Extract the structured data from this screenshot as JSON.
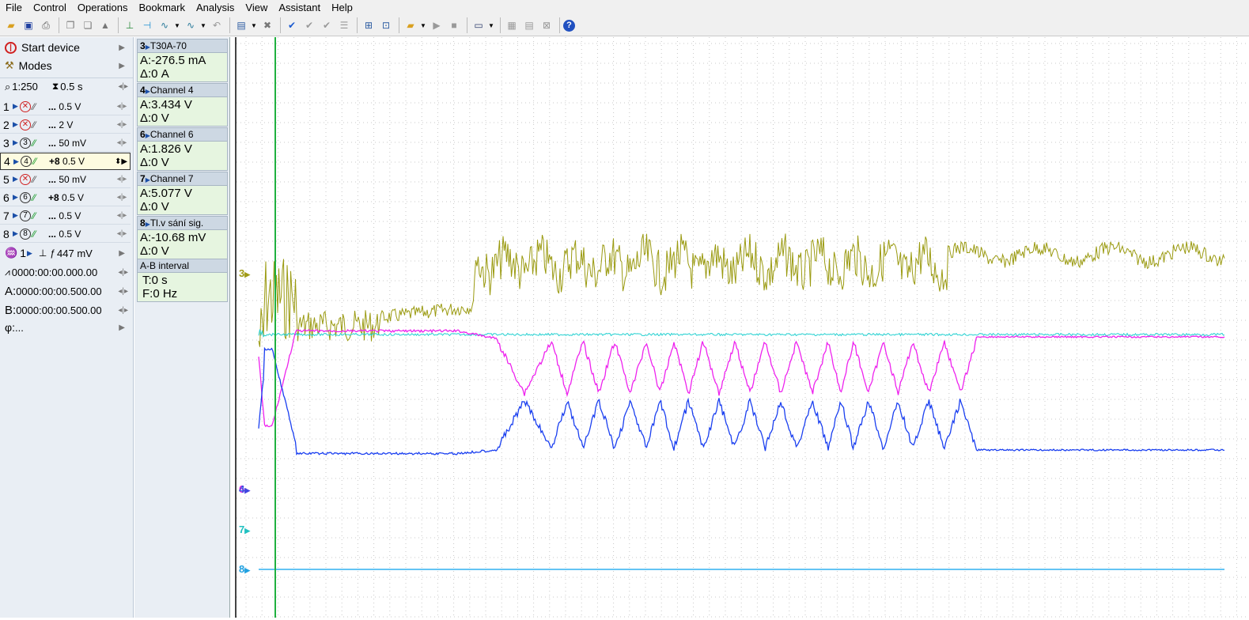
{
  "menu": [
    "File",
    "Control",
    "Operations",
    "Bookmark",
    "Analysis",
    "View",
    "Assistant",
    "Help"
  ],
  "controls": {
    "start_device": "Start device",
    "modes": "Modes",
    "zoom": "1:250",
    "timebase": "0.5 s",
    "trigger_channel": "1",
    "trigger_level": "447 mV",
    "time_readout": "0000:00:00.000.00",
    "cursor_a": "0000:00:00.500.00",
    "cursor_b": "0000:00:00.500.00",
    "cursor_a_label": "A:",
    "cursor_b_label": "B:",
    "phase_label": "φ:",
    "phase_value": "..."
  },
  "channels": [
    {
      "num": "1",
      "circle": "1",
      "off": true,
      "offset": "...",
      "scale": "0.5 V"
    },
    {
      "num": "2",
      "circle": "2",
      "off": true,
      "offset": "...",
      "scale": "2 V"
    },
    {
      "num": "3",
      "circle": "3",
      "off": false,
      "offset": "...",
      "scale": "50 mV"
    },
    {
      "num": "4",
      "circle": "4",
      "off": false,
      "offset": "+8",
      "scale": "0.5 V",
      "selected": true
    },
    {
      "num": "5",
      "circle": "5",
      "off": true,
      "offset": "...",
      "scale": "50 mV"
    },
    {
      "num": "6",
      "circle": "6",
      "off": false,
      "offset": "+8",
      "scale": "0.5 V"
    },
    {
      "num": "7",
      "circle": "7",
      "off": false,
      "offset": "...",
      "scale": "0.5 V"
    },
    {
      "num": "8",
      "circle": "8",
      "off": false,
      "offset": "...",
      "scale": "0.5 V"
    }
  ],
  "measurements": [
    {
      "id": "3",
      "title": "T30A-70",
      "a": "A:-276.5 mA",
      "d": "Δ:0 A"
    },
    {
      "id": "4",
      "title": "Channel 4",
      "a": "A:3.434 V",
      "d": "Δ:0 V"
    },
    {
      "id": "6",
      "title": "Channel 6",
      "a": "A:1.826 V",
      "d": "Δ:0 V"
    },
    {
      "id": "7",
      "title": "Channel 7",
      "a": "A:5.077 V",
      "d": "Δ:0 V"
    },
    {
      "id": "8",
      "title": "Tl.v sání sig.",
      "a": "A:-10.68 mV",
      "d": "Δ:0 V"
    }
  ],
  "interval": {
    "title": "A-B interval",
    "t": "T:0 s",
    "f": "F:0 Hz"
  },
  "scope_markers": [
    {
      "label": "3",
      "color": "#a09a14"
    },
    {
      "label": "4",
      "color": "#2050e0"
    },
    {
      "label": "6",
      "color": "#e020e0"
    },
    {
      "label": "7",
      "color": "#20c0c0"
    },
    {
      "label": "8",
      "color": "#20a0e0"
    }
  ],
  "colors": {
    "ch3": "#9a9a10",
    "ch4": "#1a3ff0",
    "ch6": "#ee22ee",
    "ch7": "#22d0d0",
    "ch8": "#30b0f0",
    "cursor": "#20b040",
    "grid": "#c8c8c8"
  }
}
